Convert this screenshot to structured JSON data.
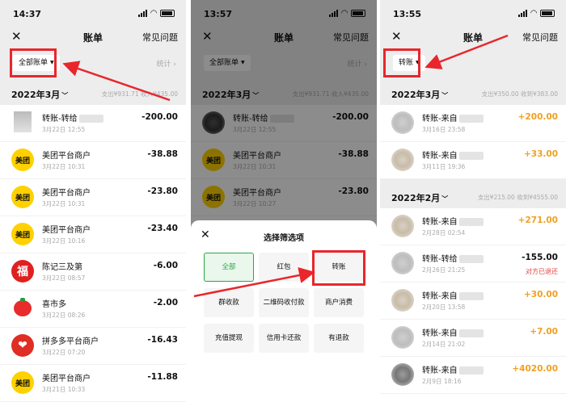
{
  "colors": {
    "accent_green": "#2aa745",
    "annotation_red": "#e8262b",
    "income_orange": "#f0a020",
    "meituan_yellow": "#ffd100"
  },
  "panel1": {
    "status_time": "14:37",
    "nav": {
      "title": "账单",
      "faq": "常见问题"
    },
    "filter_chip": "全部账单",
    "stats": "统计",
    "month": "2022年3月",
    "summary": "支出¥931.71  收入¥435.00",
    "rows": [
      {
        "name": "转账-转给",
        "date": "3月22日 12:55",
        "amount": "-200.00"
      },
      {
        "name": "美团平台商户",
        "date": "3月22日 10:31",
        "amount": "-38.88"
      },
      {
        "name": "美团平台商户",
        "date": "3月22日 10:31",
        "amount": "-23.80"
      },
      {
        "name": "美团平台商户",
        "date": "3月22日 10:16",
        "amount": "-23.40"
      },
      {
        "name": "陈记三及第",
        "date": "3月22日 08:57",
        "amount": "-6.00"
      },
      {
        "name": "喜市多",
        "date": "3月22日 08:26",
        "amount": "-2.00"
      },
      {
        "name": "拼多多平台商户",
        "date": "3月22日 07:20",
        "amount": "-16.43"
      },
      {
        "name": "美团平台商户",
        "date": "3月21日 10:33",
        "amount": "-11.88"
      }
    ]
  },
  "panel2": {
    "status_time": "13:57",
    "nav": {
      "title": "账单",
      "faq": "常见问题"
    },
    "filter_chip": "全部账单",
    "stats": "统计",
    "month": "2022年3月",
    "summary": "支出¥931.71  收入¥435.00",
    "rows": [
      {
        "name": "转账-转给",
        "date": "3月22日 12:55",
        "amount": "-200.00"
      },
      {
        "name": "美团平台商户",
        "date": "3月22日 10:31",
        "amount": "-38.88"
      },
      {
        "name": "美团平台商户",
        "date": "3月22日 10:27",
        "amount": "-23.80"
      }
    ],
    "sheet": {
      "title": "选择筛选项",
      "options": [
        "全部",
        "红包",
        "转账",
        "群收款",
        "二维码收付款",
        "商户消费",
        "充值提现",
        "信用卡还款",
        "有退款"
      ]
    }
  },
  "panel3": {
    "status_time": "13:55",
    "nav": {
      "title": "账单",
      "faq": "常见问题"
    },
    "filter_chip": "转账",
    "month1": "2022年3月",
    "summary1": "支出¥350.00  收到¥383.00",
    "rows1": [
      {
        "name": "转账-来自",
        "date": "3月16日 23:58",
        "amount": "+200.00"
      },
      {
        "name": "转账-来自",
        "date": "3月11日 19:36",
        "amount": "+33.00"
      }
    ],
    "month2": "2022年2月",
    "summary2": "支出¥215.00  收到¥4555.00",
    "rows2": [
      {
        "name": "转账-来自",
        "date": "2月28日 02:54",
        "amount": "+271.00",
        "note": ""
      },
      {
        "name": "转账-转给",
        "date": "2月26日 21:25",
        "amount": "-155.00",
        "note": "对方已退还"
      },
      {
        "name": "转账-来自",
        "date": "2月20日 13:58",
        "amount": "+30.00",
        "note": ""
      },
      {
        "name": "转账-来自",
        "date": "2月14日 21:02",
        "amount": "+7.00",
        "note": ""
      },
      {
        "name": "转账-来自",
        "date": "2月9日 18:16",
        "amount": "+4020.00",
        "note": ""
      }
    ]
  }
}
